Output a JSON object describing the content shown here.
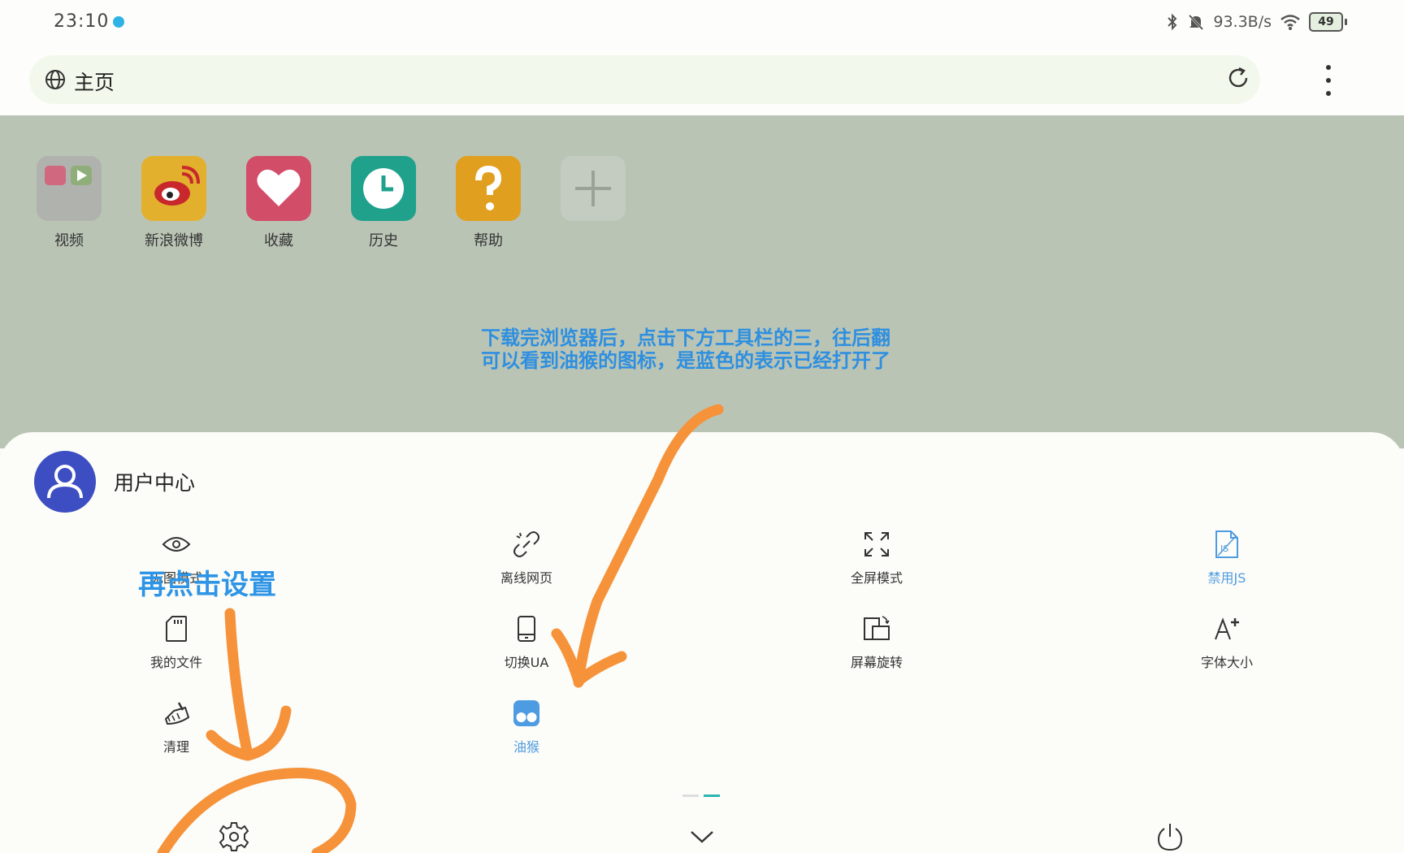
{
  "status_bar": {
    "time": "23:10",
    "speed": "93.3B/s",
    "battery": "49",
    "icons": [
      "bluetooth-icon",
      "mute-icon",
      "wifi-icon",
      "battery-icon"
    ]
  },
  "address_bar": {
    "title": "主页",
    "icons": [
      "globe-icon",
      "reload-icon",
      "more-icon"
    ]
  },
  "shortcuts": [
    {
      "label": "视频",
      "color": "#b0b2ad"
    },
    {
      "label": "新浪微博",
      "color": "#e3b02e"
    },
    {
      "label": "收藏",
      "color": "#d24d68"
    },
    {
      "label": "历史",
      "color": "#1fa18b"
    },
    {
      "label": "帮助",
      "color": "#e09f1f"
    },
    {
      "label": "",
      "color": "#c4cbc0"
    }
  ],
  "annotation": {
    "text": "下载完浏览器后，点击下方工具栏的三，往后翻\n可以看到油猴的图标，是蓝色的表示已经打开了",
    "color": "#2e8fe0"
  },
  "menu": {
    "user_center": "用户中心",
    "items": [
      {
        "label": "无图模式",
        "icon": "eye-icon",
        "active": false
      },
      {
        "label": "离线网页",
        "icon": "offline-link-icon",
        "active": false
      },
      {
        "label": "全屏模式",
        "icon": "fullscreen-icon",
        "active": false
      },
      {
        "label": "禁用JS",
        "icon": "js-file-icon",
        "active": true
      },
      {
        "label": "我的文件",
        "icon": "sd-card-icon",
        "active": false
      },
      {
        "label": "切换UA",
        "icon": "phone-icon",
        "active": false
      },
      {
        "label": "屏幕旋转",
        "icon": "rotate-screen-icon",
        "active": false
      },
      {
        "label": "字体大小",
        "icon": "font-size-icon",
        "active": false
      },
      {
        "label": "清理",
        "icon": "broom-icon",
        "active": false
      },
      {
        "label": "油猴",
        "icon": "tampermonkey-icon",
        "active": true
      }
    ],
    "bottom_icons": [
      "settings-icon",
      "collapse-chevron-icon",
      "power-icon"
    ],
    "accent_color": "#4d9be0"
  },
  "overlay": {
    "handwritten_text": "再点击设置",
    "stroke_color": "#f5923a"
  }
}
